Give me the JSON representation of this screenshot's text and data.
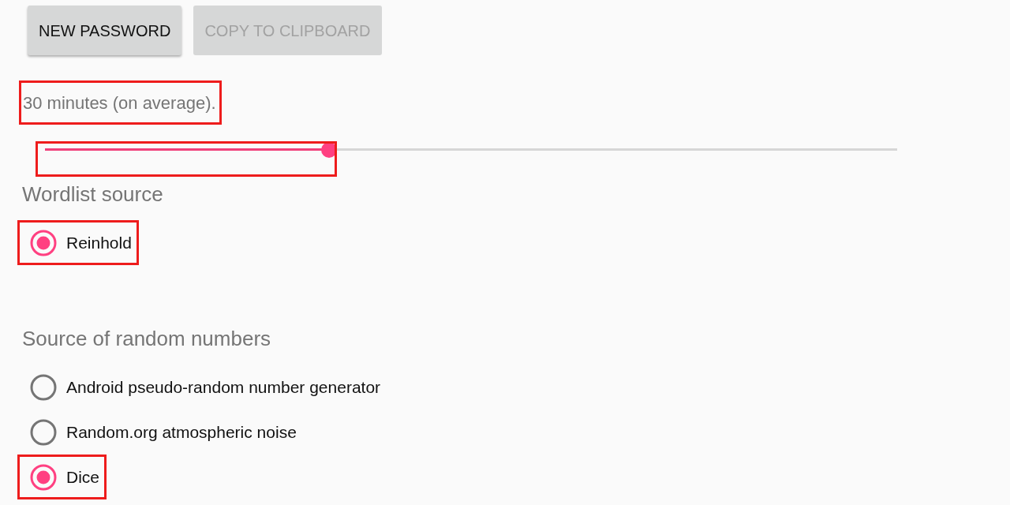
{
  "actions": [
    {
      "label": "NEW PASSWORD",
      "disabled": false
    },
    {
      "label": "COPY TO CLIPBOARD",
      "disabled": true
    }
  ],
  "estimate": {
    "text": "30 minutes (on average).",
    "highlighted": true
  },
  "strength_slider": {
    "level": 0.333,
    "highlighted": true
  },
  "sections": [
    {
      "title": "Wordlist source",
      "options": [
        {
          "label": "Reinhold",
          "selected": true,
          "highlighted": true
        }
      ]
    },
    {
      "title": "Source of random numbers",
      "options": [
        {
          "label": "Android pseudo-random number generator",
          "selected": false,
          "highlighted": false
        },
        {
          "label": "Random.org atmospheric noise",
          "selected": false,
          "highlighted": false
        },
        {
          "label": "Dice",
          "selected": true,
          "highlighted": true
        }
      ]
    }
  ]
}
